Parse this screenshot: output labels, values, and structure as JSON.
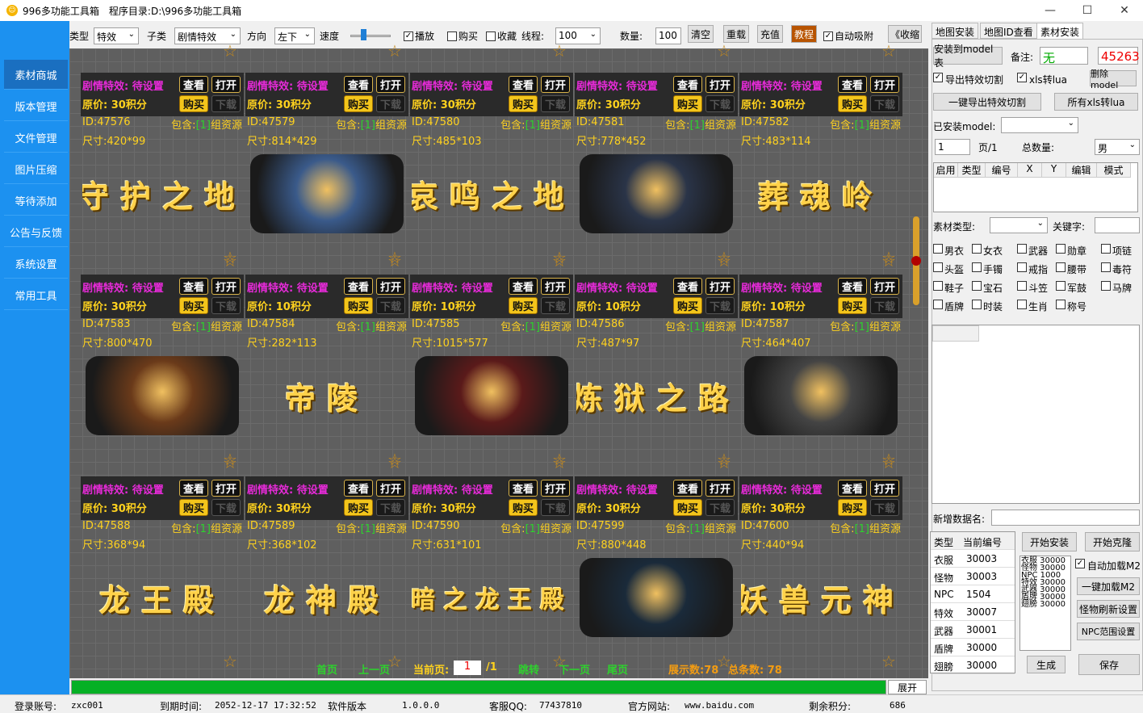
{
  "window": {
    "title": "996多功能工具箱",
    "dir_label": "程序目录:",
    "dir": "D:\\996多功能工具箱",
    "min": "—",
    "max": "☐",
    "close": "✕"
  },
  "sidebar": [
    "素材商城",
    "版本管理",
    "文件管理",
    "图片压缩",
    "等待添加",
    "公告与反馈",
    "系统设置",
    "常用工具"
  ],
  "toolbar": {
    "type_label": "类型",
    "type": "特效",
    "sub_label": "子类",
    "sub": "剧情特效",
    "dir_label": "方向",
    "dir": "左下",
    "speed_label": "速度",
    "play": "播放",
    "buy": "购买",
    "fav": "收藏",
    "thread_label": "线程:",
    "thread": "100",
    "qty_label": "数量:",
    "qty": "100",
    "clear": "清空",
    "reload": "重载",
    "recharge": "充值",
    "tutorial": "教程",
    "auto_attach": "自动吸附",
    "collapse": "《收缩"
  },
  "card_btns": {
    "view": "查看",
    "open": "打开",
    "buy": "购买",
    "dl": "下载",
    "contains": "包含:",
    "res": "组资源",
    "count": "[1]"
  },
  "cards": [
    {
      "title": "剧情特效: 待设置",
      "price": "原价: 30积分",
      "id": "ID:47576",
      "size": "尺寸:420*99",
      "art": "守护之地"
    },
    {
      "title": "剧情特效: 待设置",
      "price": "原价: 30积分",
      "id": "ID:47579",
      "size": "尺寸:814*429",
      "art": ""
    },
    {
      "title": "剧情特效: 待设置",
      "price": "原价: 30积分",
      "id": "ID:47580",
      "size": "尺寸:485*103",
      "art": "哀鸣之地"
    },
    {
      "title": "剧情特效: 待设置",
      "price": "原价: 30积分",
      "id": "ID:47581",
      "size": "尺寸:778*452",
      "art": ""
    },
    {
      "title": "剧情特效: 待设置",
      "price": "原价: 30积分",
      "id": "ID:47582",
      "size": "尺寸:483*114",
      "art": "葬魂岭"
    },
    {
      "title": "剧情特效: 待设置",
      "price": "原价: 30积分",
      "id": "ID:47583",
      "size": "尺寸:800*470",
      "art": ""
    },
    {
      "title": "剧情特效: 待设置",
      "price": "原价: 10积分",
      "id": "ID:47584",
      "size": "尺寸:282*113",
      "art": "帝陵"
    },
    {
      "title": "剧情特效: 待设置",
      "price": "原价: 10积分",
      "id": "ID:47585",
      "size": "尺寸:1015*577",
      "art": ""
    },
    {
      "title": "剧情特效: 待设置",
      "price": "原价: 10积分",
      "id": "ID:47586",
      "size": "尺寸:487*97",
      "art": "炼狱之路"
    },
    {
      "title": "剧情特效: 待设置",
      "price": "原价: 10积分",
      "id": "ID:47587",
      "size": "尺寸:464*407",
      "art": ""
    },
    {
      "title": "剧情特效: 待设置",
      "price": "原价: 30积分",
      "id": "ID:47588",
      "size": "尺寸:368*94",
      "art": "龙王殿"
    },
    {
      "title": "剧情特效: 待设置",
      "price": "原价: 30积分",
      "id": "ID:47589",
      "size": "尺寸:368*102",
      "art": "龙神殿"
    },
    {
      "title": "剧情特效: 待设置",
      "price": "原价: 30积分",
      "id": "ID:47590",
      "size": "尺寸:631*101",
      "art": "暗之龙王殿"
    },
    {
      "title": "剧情特效: 待设置",
      "price": "原价: 30积分",
      "id": "ID:47599",
      "size": "尺寸:880*448",
      "art": ""
    },
    {
      "title": "剧情特效: 待设置",
      "price": "原价: 30积分",
      "id": "ID:47600",
      "size": "尺寸:440*94",
      "art": "妖兽元神"
    }
  ],
  "pager": {
    "first": "首页",
    "prev": "上一页",
    "cur_label": "当前页:",
    "cur": "1",
    "total": "/1",
    "jump": "跳转",
    "next": "下一页",
    "last": "尾页",
    "shown": "展示数:78",
    "total_count": "总条数: 78"
  },
  "progress": 1.0,
  "expand": "展开",
  "status": {
    "acct_label": "登录账号:",
    "acct": "zxc001",
    "exp_label": "到期时间:",
    "exp": "2052-12-17 17:32:52",
    "ver_label": "软件版本",
    "ver": "1.0.0.0",
    "qq_label": "客服QQ:",
    "qq": "77437810",
    "site_label": "官方网站:",
    "site": "www.baidu.com",
    "pts_label": "剩余积分:",
    "pts": "686"
  },
  "right": {
    "tabs": [
      "地图安装",
      "地图ID查看",
      "素材安装"
    ],
    "install_model": "安装到model表",
    "note_label": "备注:",
    "note": "无",
    "points": "45263",
    "export_cut": "导出特效切割",
    "xls_lua": "xls转lua",
    "del_model": "删除model",
    "one_export": "一键导出特效切割",
    "all_xls": "所有xls转lua",
    "installed_label": "已安装model:",
    "page": "1",
    "page_suffix": "页/1",
    "total_label": "总数量:",
    "gender": "男",
    "grid_cols": [
      "启用",
      "类型",
      "编号",
      "X",
      "Y",
      "编辑",
      "模式"
    ],
    "mat_type_label": "素材类型:",
    "keyword_label": "关键字:",
    "checks": [
      "男衣",
      "女衣",
      "武器",
      "勋章",
      "项链",
      "头盔",
      "手镯",
      "戒指",
      "腰带",
      "毒符",
      "鞋子",
      "宝石",
      "斗笠",
      "军鼓",
      "马牌",
      "盾牌",
      "时装",
      "生肖",
      "称号"
    ],
    "new_data_label": "新增数据名:",
    "tbl_head": [
      "类型",
      "当前编号"
    ],
    "tbl_rows": [
      [
        "衣服",
        "30003"
      ],
      [
        "怪物",
        "30003"
      ],
      [
        "NPC",
        "1504"
      ],
      [
        "特效",
        "30007"
      ],
      [
        "武器",
        "30001"
      ],
      [
        "盾牌",
        "30000"
      ],
      [
        "翅膀",
        "30000"
      ]
    ],
    "mini_list": [
      "衣服 30000",
      "怪物 30000",
      "NPC  1000",
      "特效 30000",
      "武器 30000",
      "盾牌 30000",
      "翅膀 30000"
    ],
    "start_install": "开始安装",
    "start_clone": "开始克隆",
    "auto_load": "自动加载M2",
    "one_load": "一键加载M2",
    "refresh": "怪物刷新设置",
    "npc_range": "NPC范围设置",
    "generate": "生成",
    "save": "保存"
  }
}
